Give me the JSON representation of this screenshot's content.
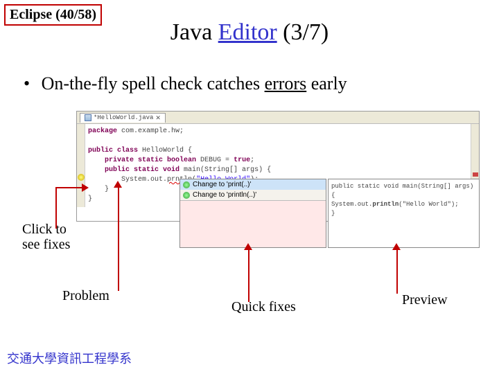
{
  "slide_counter": "Eclipse (40/58)",
  "title": {
    "prefix": "Java ",
    "link": "Editor",
    "suffix": "  (3/7)"
  },
  "bullet": {
    "pre": "On-the-fly spell check catches ",
    "err": "errors",
    "post": " early"
  },
  "editor": {
    "tab": "*HelloWorld.java",
    "lines": {
      "l1a": "package",
      "l1b": " com.example.hw;",
      "l3a": "public class",
      "l3b": " HelloWorld {",
      "l4a": "private static boolean",
      "l4b": " DEBUG = ",
      "l4c": "true",
      "l4d": ";",
      "l5a": "public static void",
      "l5b": " main(String[] args) {",
      "l6a": "System.out.",
      "l6err": "prntln",
      "l6b": "(",
      "l6str": "\"Hello World\"",
      "l6c": ");",
      "l7": "}",
      "l8": "}"
    }
  },
  "quickfix": {
    "items": [
      "Change to 'print(..)'",
      "Change to 'println(..)'"
    ]
  },
  "preview": {
    "l1": "public static void main(String[] args) {",
    "l2pre": "  System.out.",
    "l2b": "println",
    "l2post": "(\"Hello World\");",
    "l3": "}"
  },
  "callouts": {
    "click": "Click to see fixes",
    "problem": "Problem",
    "quick": "Quick fixes",
    "preview": "Preview"
  },
  "footer": "交通大學資訊工程學系"
}
